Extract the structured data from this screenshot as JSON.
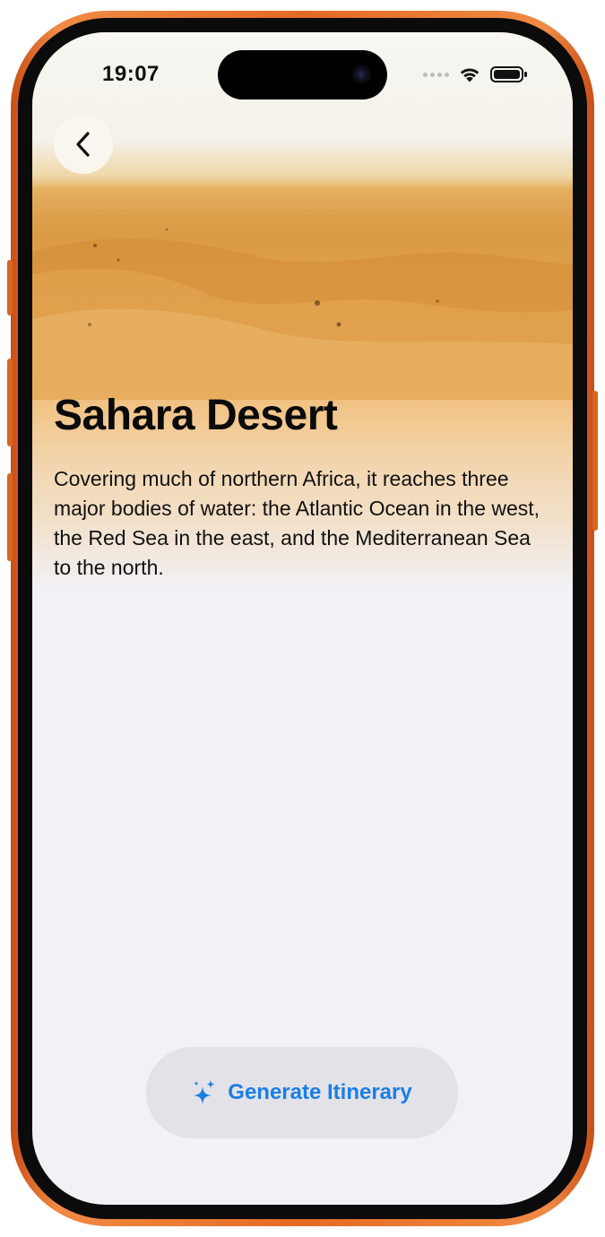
{
  "status_bar": {
    "time": "19:07"
  },
  "icons": {
    "back": "chevron-left-icon",
    "wifi": "wifi-icon",
    "battery": "battery-icon",
    "sparkles": "sparkles-icon",
    "signal": "signal-dots-icon"
  },
  "destination": {
    "title": "Sahara Desert",
    "description": "Covering much of northern Africa, it reaches three major bodies of water: the Atlantic Ocean in the west, the Red Sea in the east, and the Mediterranean Sea to the north."
  },
  "actions": {
    "generate_label": "Generate Itinerary"
  },
  "colors": {
    "accent": "#1a7fe6",
    "device_frame": "#e46a24",
    "screen_background": "#f2f1f6",
    "button_background": "#e3e2e8"
  }
}
